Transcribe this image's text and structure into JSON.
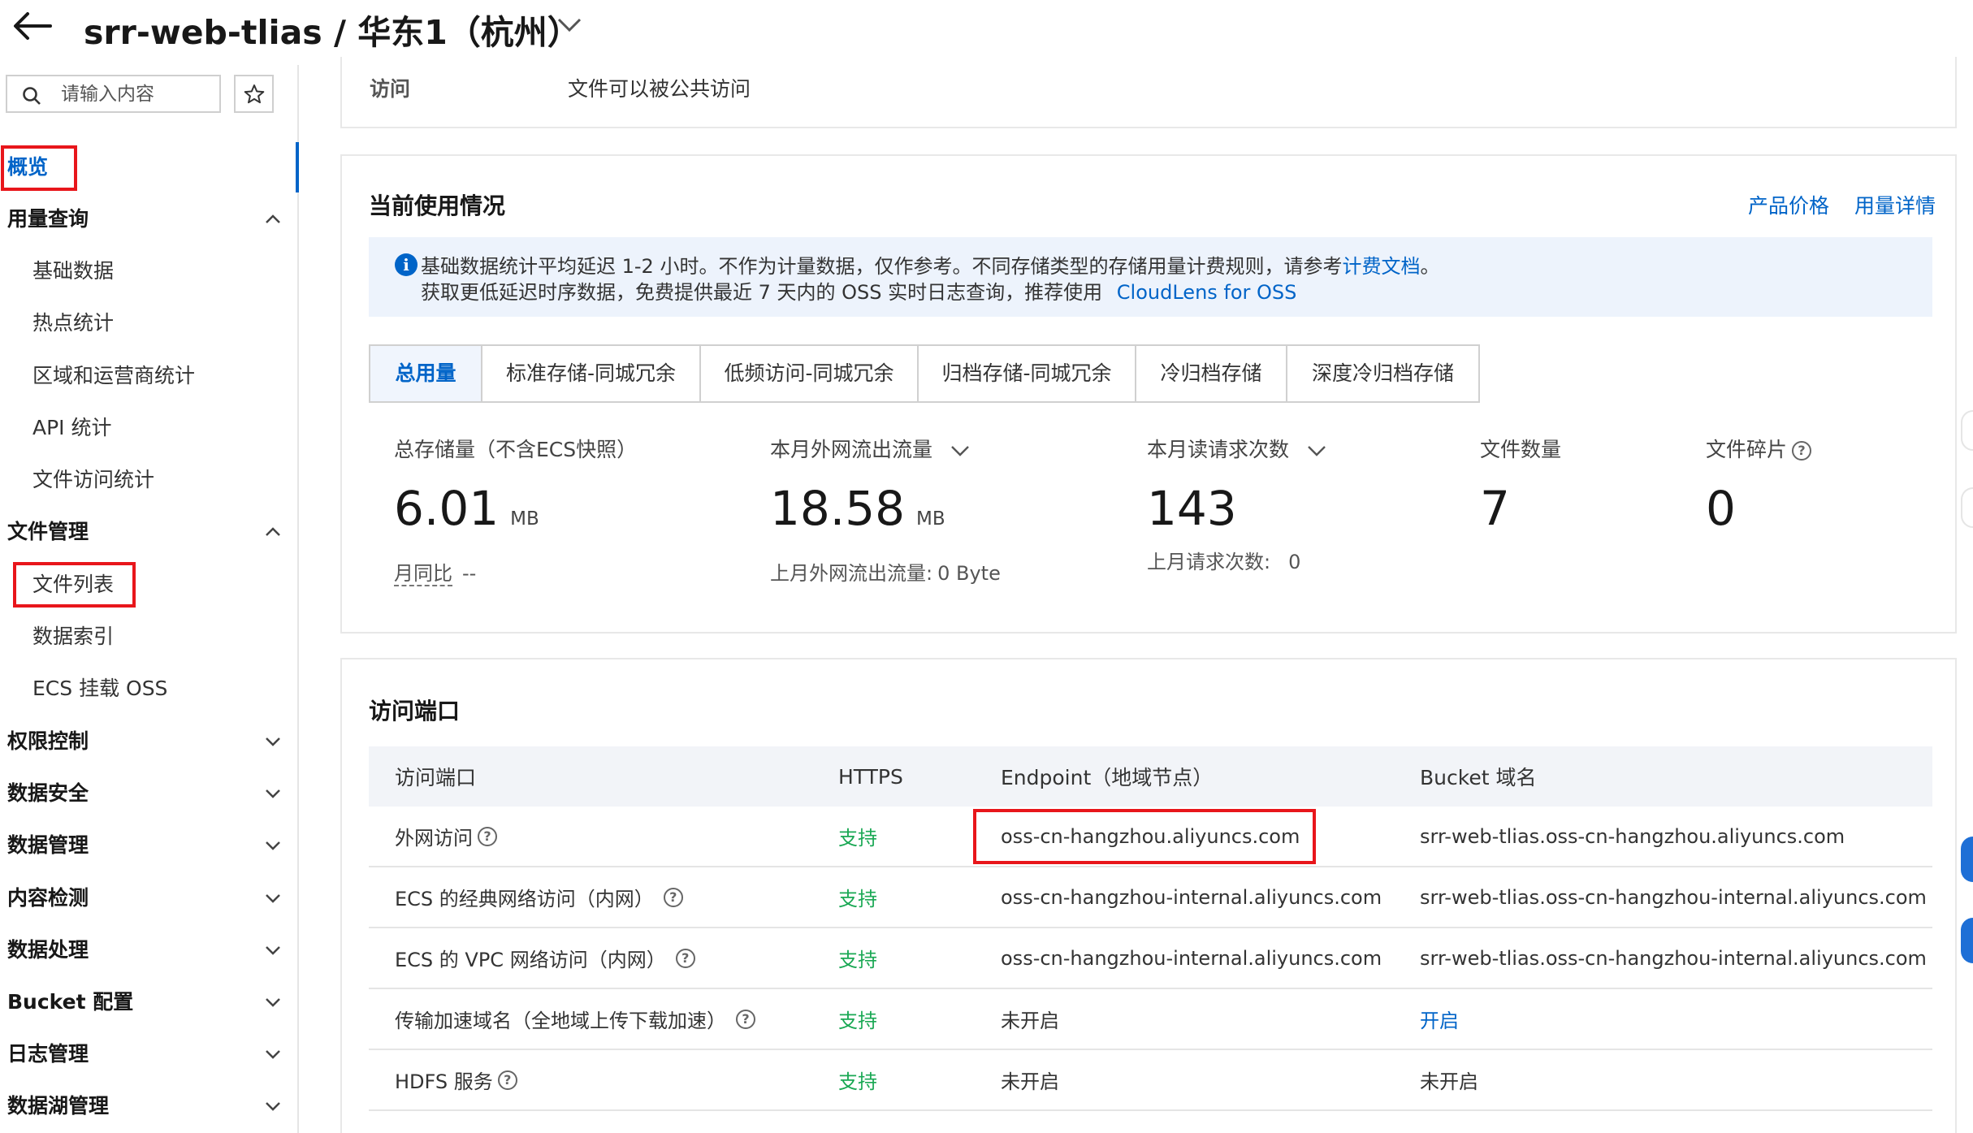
{
  "header": {
    "bucket_title": "srr-web-tlias / 华东1（杭州）"
  },
  "sidebar": {
    "search_placeholder": "请输入内容",
    "overview": "概览",
    "groups": [
      {
        "label": "用量查询",
        "expanded": true,
        "items": [
          "基础数据",
          "热点统计",
          "区域和运营商统计",
          "API 统计",
          "文件访问统计"
        ]
      },
      {
        "label": "文件管理",
        "expanded": true,
        "items": [
          "文件列表",
          "数据索引",
          "ECS 挂载 OSS"
        ]
      },
      {
        "label": "权限控制",
        "expanded": false
      },
      {
        "label": "数据安全",
        "expanded": false
      },
      {
        "label": "数据管理",
        "expanded": false
      },
      {
        "label": "内容检测",
        "expanded": false
      },
      {
        "label": "数据处理",
        "expanded": false
      },
      {
        "label": "Bucket 配置",
        "expanded": false
      },
      {
        "label": "日志管理",
        "expanded": false
      },
      {
        "label": "数据湖管理",
        "expanded": false
      }
    ]
  },
  "access": {
    "label": "访问",
    "value": "文件可以被公共访问"
  },
  "usage": {
    "title": "当前使用情况",
    "links": [
      "产品价格",
      "用量详情"
    ],
    "notice": {
      "line1_text": "基础数据统计平均延迟 1-2 小时。不作为计量数据，仅作参考。不同存储类型的存储用量计费规则，请参考",
      "line1_link": "计费文档",
      "line1_end": "。",
      "line2_text": "获取更低延迟时序数据，免费提供最近 7 天内的 OSS 实时日志查询，推荐使用",
      "line2_link": "CloudLens for OSS"
    },
    "tabs": [
      "总用量",
      "标准存储-同城冗余",
      "低频访问-同城冗余",
      "归档存储-同城冗余",
      "冷归档存储",
      "深度冷归档存储"
    ],
    "active_tab": "总用量",
    "metrics": [
      {
        "label": "总存储量（不含ECS快照）",
        "value": "6.01",
        "unit": "MB",
        "sub_label": "月同比",
        "sub_value": "--"
      },
      {
        "label": "本月外网流出流量",
        "value": "18.58",
        "unit": "MB",
        "sub_label": "上月外网流出流量:",
        "sub_value": "0 Byte"
      },
      {
        "label": "本月读请求次数",
        "value": "143",
        "unit": "",
        "sub_label": "上月请求次数:",
        "sub_value": "0"
      },
      {
        "label": "文件数量",
        "value": "7",
        "unit": ""
      },
      {
        "label": "文件碎片",
        "value": "0",
        "unit": ""
      }
    ]
  },
  "endpoints": {
    "title": "访问端口",
    "columns": [
      "访问端口",
      "HTTPS",
      "Endpoint（地域节点）",
      "Bucket 域名"
    ],
    "rows": [
      {
        "port": "外网访问",
        "https": "支持",
        "endpoint": "oss-cn-hangzhou.aliyuncs.com",
        "domain": "srr-web-tlias.oss-cn-hangzhou.aliyuncs.com"
      },
      {
        "port": "ECS 的经典网络访问（内网）",
        "https": "支持",
        "endpoint": "oss-cn-hangzhou-internal.aliyuncs.com",
        "domain": "srr-web-tlias.oss-cn-hangzhou-internal.aliyuncs.com"
      },
      {
        "port": "ECS 的 VPC 网络访问（内网）",
        "https": "支持",
        "endpoint": "oss-cn-hangzhou-internal.aliyuncs.com",
        "domain": "srr-web-tlias.oss-cn-hangzhou-internal.aliyuncs.com"
      },
      {
        "port": "传输加速域名（全地域上传下载加速）",
        "https": "支持",
        "endpoint": "未开启",
        "domain": "开启"
      },
      {
        "port": "HDFS 服务",
        "https": "支持",
        "endpoint": "未开启",
        "domain": "未开启"
      }
    ]
  },
  "colors": {
    "accent": "#0064c8",
    "success": "#1aa854",
    "highlight_box": "#e8161b",
    "notice_bg": "#edf3fc"
  },
  "icons": [
    "back-arrow-icon",
    "chevron-down-icon",
    "search-icon",
    "star-icon",
    "chevron-up-icon",
    "info-icon",
    "question-icon"
  ]
}
